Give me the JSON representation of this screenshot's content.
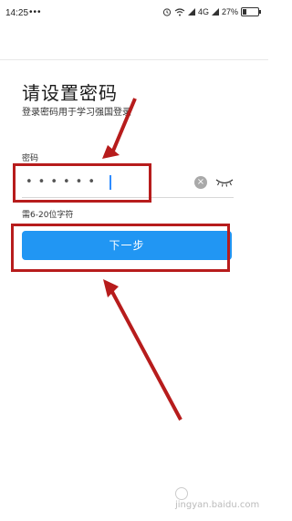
{
  "status_bar": {
    "time": "14:25",
    "more": "•••",
    "network": "4G",
    "battery": "27%",
    "battery_level": 0.27
  },
  "page": {
    "title": "请设置密码",
    "subtitle": "登录密码用于学习强国登录"
  },
  "password": {
    "label": "密码",
    "masked_value": "••••••",
    "hint": "需6-20位字符"
  },
  "actions": {
    "next_label": "下一步"
  },
  "colors": {
    "primary": "#2196f3",
    "annotation": "#b71c1c"
  },
  "icons": {
    "clear": "clear-icon",
    "visibility": "eye-closed-icon"
  },
  "watermark": {
    "text": "jingyan.baidu.com"
  }
}
